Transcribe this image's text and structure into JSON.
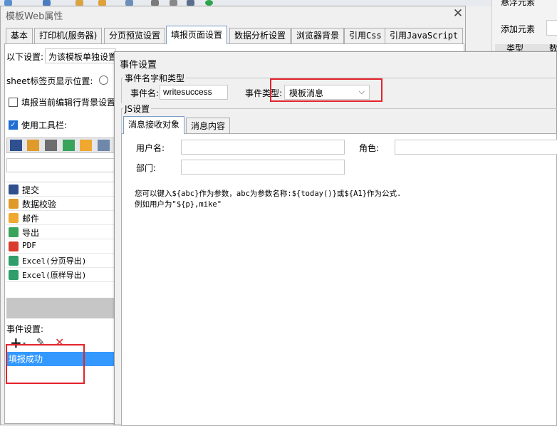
{
  "outer_dialog": {
    "title": "模板Web属性",
    "close_glyph": "✕",
    "tabs": [
      "基本",
      "打印机(服务器)",
      "分页预览设置",
      "填报页面设置",
      "数据分析设置",
      "浏览器背景",
      "引用Css",
      "引用JavaScript"
    ],
    "active_tab": "填报页面设置"
  },
  "right_panel": {
    "float_label": "悬浮元素",
    "add_label": "添加元素",
    "col_type": "类型",
    "col_data": "数"
  },
  "settings": {
    "intro_label": "以下设置:",
    "intro_value": "为该模板单独设置",
    "sheet_tab_label": "sheet标签页显示位置:",
    "fill_bg_label": "填报当前编辑行背景设置",
    "use_toolbar_label": "使用工具栏:"
  },
  "toolbar_buttons": [
    {
      "label": "提交",
      "icon": "save-icon",
      "color": "#2f4f8f"
    },
    {
      "label": "数据校验",
      "icon": "pencil-icon",
      "color": "#e09a2a"
    },
    {
      "label": "邮件",
      "icon": "email-icon",
      "color": "#f0a830"
    },
    {
      "label": "导出",
      "icon": "export-icon",
      "color": "#3aa35a"
    },
    {
      "label": "PDF",
      "icon": "pdf-icon",
      "color": "#d93a2b"
    },
    {
      "label": "Excel(分页导出)",
      "icon": "excel-icon",
      "color": "#2f9e6a"
    },
    {
      "label": "Excel(原样导出)",
      "icon": "excel-icon",
      "color": "#2f9e6a"
    }
  ],
  "event_settings": {
    "label": "事件设置:",
    "add_glyph": "+",
    "remove_glyph": "✕",
    "items": [
      "填报成功"
    ]
  },
  "inner_dialog": {
    "title": "事件设置",
    "name_group_label": "事件名字和类型",
    "event_name_label": "事件名:",
    "event_name_value": "writesuccess",
    "event_type_label": "事件类型:",
    "event_type_value": "模板消息",
    "js_group_label": "JS设置",
    "tabs": [
      "消息接收对象",
      "消息内容"
    ],
    "user_label": "用户名:",
    "role_label": "角色:",
    "dept_label": "部门:",
    "help_line1": "您可以键入${abc}作为参数，abc为参数名称:${today()}或${A1}作为公式.",
    "help_line2": "例如用户为\"${p},mike\""
  },
  "colors": {
    "accent": "#3399ff",
    "highlight_box": "#e4232b",
    "active_tab_border": "#7a9cc7"
  }
}
